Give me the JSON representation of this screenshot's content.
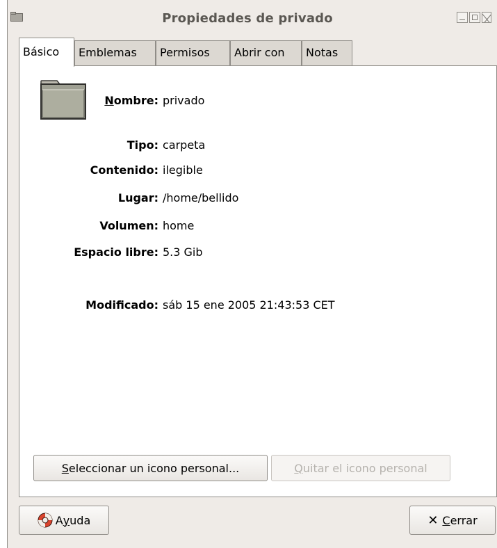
{
  "window": {
    "title": "Propiedades de privado",
    "controls": [
      "minimize-icon",
      "maximize-icon",
      "close-icon"
    ]
  },
  "tabs": [
    {
      "label": "Básico",
      "active": true
    },
    {
      "label": "Emblemas",
      "active": false
    },
    {
      "label": "Permisos",
      "active": false
    },
    {
      "label": "Abrir con",
      "active": false
    },
    {
      "label": "Notas",
      "active": false
    }
  ],
  "basic": {
    "icon": "folder-icon",
    "name_label_mnemonic": "N",
    "name_label_rest": "ombre:",
    "name_value": "privado",
    "fields": [
      {
        "label": "Tipo:",
        "value": "carpeta"
      },
      {
        "label": "Contenido:",
        "value": "ilegible"
      },
      {
        "label": "Lugar:",
        "value": "/home/bellido"
      },
      {
        "label": "Volumen:",
        "value": "home"
      },
      {
        "label": "Espacio libre:",
        "value": "5.3 Gib"
      }
    ],
    "modified_label": "Modificado:",
    "modified_value": "sáb 15 ene 2005 21:43:53 CET",
    "select_icon_mnemonic": "S",
    "select_icon_rest": "eleccionar un icono personal...",
    "remove_icon_mnemonic": "Q",
    "remove_icon_rest": "uitar el icono personal"
  },
  "footer": {
    "help_pre": "A",
    "help_mnemonic": "y",
    "help_rest": "uda",
    "close_mnemonic": "C",
    "close_rest": "errar",
    "help_icon": "lifebuoy-icon",
    "close_icon": "x-icon"
  }
}
